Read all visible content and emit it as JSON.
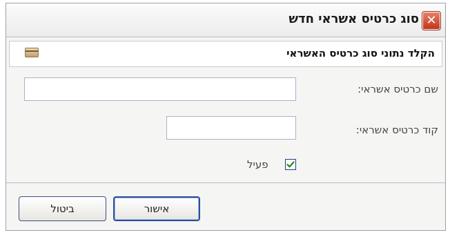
{
  "window": {
    "title": "סוג כרטיס אשראי חדש",
    "close_symbol": "✕"
  },
  "header": {
    "text": "הקלד נתוני סוג כרטיס האשראי",
    "icon": "credit-card-icon"
  },
  "form": {
    "card_name_label": "שם כרטיס אשראי:",
    "card_name_value": "",
    "card_code_label": "קוד כרטיס אשראי:",
    "card_code_value": "",
    "active_label": "פעיל",
    "active_checked": true
  },
  "buttons": {
    "ok_label": "אישור",
    "cancel_label": "ביטול"
  },
  "colors": {
    "close_button": "#c2341a",
    "checkmark": "#1a8a1a",
    "default_button_border": "#2c4f9a"
  }
}
